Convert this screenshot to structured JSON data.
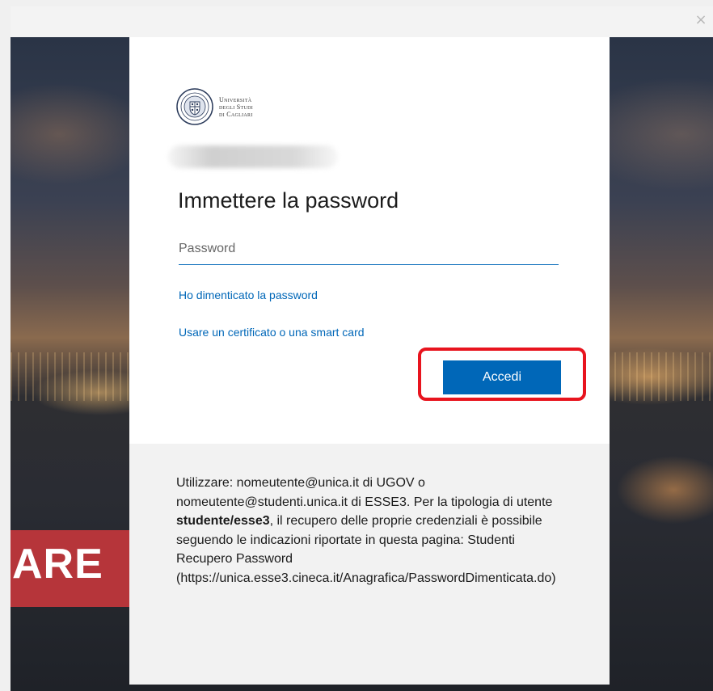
{
  "window": {
    "close_glyph": "×"
  },
  "background": {
    "banner_text": "ARE"
  },
  "logo": {
    "line1": "Università",
    "line2": "degli Studi",
    "line3": "di Cagliari",
    "icon": "university-seal-icon"
  },
  "login": {
    "heading": "Immettere la password",
    "password_placeholder": "Password",
    "password_value": "",
    "forgot_link": "Ho dimenticato la password",
    "cert_link": "Usare un certificato o una smart card",
    "submit_label": "Accedi"
  },
  "footer": {
    "text_before_bold": "Utilizzare: nomeutente@unica.it di UGOV o nomeutente@studenti.unica.it di ESSE3. Per la tipologia di utente ",
    "bold_text": "studente/esse3",
    "text_after_bold": ", il recupero delle proprie credenziali è possibile seguendo le indicazioni riportate in questa pagina: Studenti Recupero Password (https://unica.esse3.cineca.it/Anagrafica/PasswordDimenticata.do)"
  },
  "colors": {
    "accent": "#0067b8",
    "highlight": "#e8141e",
    "banner": "#b6353a"
  }
}
